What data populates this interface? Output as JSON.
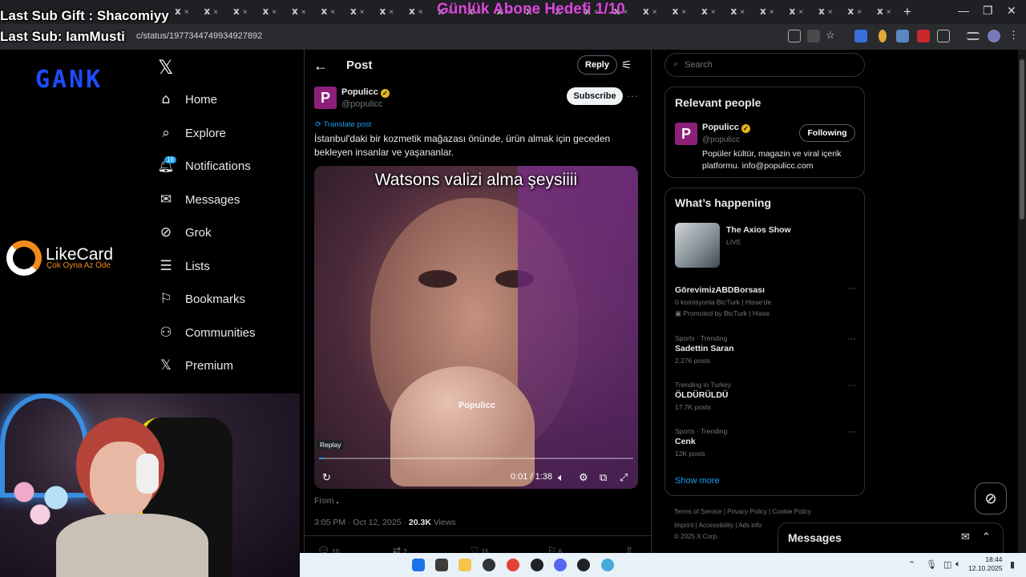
{
  "browser": {
    "tabs": [
      "x",
      "x",
      "x",
      "x",
      "x",
      "x",
      "x",
      "x",
      "x",
      "x",
      "x",
      "x",
      "x",
      "x",
      "x",
      "x",
      "x",
      "x",
      "x",
      "x",
      "x",
      "x",
      "x",
      "x",
      "x"
    ],
    "url_fragment": "c/status/1977344749934927892",
    "new_tab": "+"
  },
  "stream_overlay": {
    "last_sub_gift": "Last Sub Gift : Shacomiyy",
    "last_sub": "Last Sub: IamMusti",
    "goal": "Günlük Abone Hedefi 1/10"
  },
  "sidebar_branding": {
    "gank": "GANK",
    "likecard_name": "LikeCard",
    "likecard_tagline": "Çok Oyna  Az Öde"
  },
  "nav": {
    "items": [
      {
        "label": "Home",
        "icon": "home-icon"
      },
      {
        "label": "Explore",
        "icon": "search-icon"
      },
      {
        "label": "Notifications",
        "icon": "bell-icon"
      },
      {
        "label": "Messages",
        "icon": "mail-icon"
      },
      {
        "label": "Grok",
        "icon": "grok-icon"
      },
      {
        "label": "Lists",
        "icon": "list-icon"
      },
      {
        "label": "Bookmarks",
        "icon": "bookmark-icon"
      },
      {
        "label": "Communities",
        "icon": "people-icon"
      },
      {
        "label": "Premium",
        "icon": "x-icon"
      }
    ],
    "notifications_badge": "16"
  },
  "post_header": {
    "title": "Post",
    "reply_label": "Reply"
  },
  "post": {
    "avatar_letter": "P",
    "author_name": "Populicc",
    "author_handle": "@populicc",
    "subscribe_label": "Subscribe",
    "translate_label": "Translate post",
    "text": "İstanbul'daki bir kozmetik mağazası önünde, ürün almak için geceden bekleyen insanlar ve yaşananlar.",
    "video": {
      "caption": "Watsons valizi alma şeysiiii",
      "watermark": "Populicc",
      "replay_tooltip": "Replay",
      "time": "0:01 / 1:38",
      "progress": 0.012
    },
    "from_label": "From",
    "from_value": ".",
    "timestamp": "3:05 PM · Oct 12, 2025 · ",
    "views_count": "20.3K",
    "views_label": " Views",
    "actions": [
      {
        "icon": "reply-icon",
        "count": "10"
      },
      {
        "icon": "repost-icon",
        "count": "2"
      },
      {
        "icon": "like-icon",
        "count": "15"
      },
      {
        "icon": "bookmark-icon",
        "count": "6"
      },
      {
        "icon": "share-icon",
        "count": ""
      }
    ]
  },
  "search": {
    "placeholder": "Search"
  },
  "relevant_people": {
    "title": "Relevant people",
    "avatar_letter": "P",
    "name": "Populicc",
    "handle": "@populicc",
    "button": "Following",
    "bio": "Popüler kültür, magazin ve viral içerik platformu. info@populicc.com"
  },
  "whats_happening": {
    "title": "What’s happening",
    "featured": {
      "name": "The Axios Show",
      "status": "LIVE"
    },
    "trends": [
      {
        "context": "",
        "name": "GörevimizABDBorsası",
        "count": "0 komisyonla BtcTurk | Hisse'de",
        "promo": "Promoted by BtcTurk | Hisse"
      },
      {
        "context": "Sports · Trending",
        "name": "Sadettin Saran",
        "count": "2,276 posts",
        "promo": ""
      },
      {
        "context": "Trending in Turkey",
        "name": "ÖLDÜRÜLDÜ",
        "count": "17.7K posts",
        "promo": ""
      },
      {
        "context": "Sports · Trending",
        "name": "Cenk",
        "count": "12K posts",
        "promo": ""
      }
    ],
    "show_more": "Show more"
  },
  "footer": {
    "line1": [
      "Terms of Service",
      "Privacy Policy",
      "Cookie Policy"
    ],
    "line2": [
      "Imprint",
      "Accessibility",
      "Ads info"
    ],
    "copyright": "© 2025 X Corp."
  },
  "messages_dock": {
    "title": "Messages"
  },
  "taskbar": {
    "time": "18:44",
    "date": "12.10.2025"
  },
  "colors": {
    "accent": "#1d9bf0",
    "goal_text": "#d34bd6",
    "gank_blue": "#1e4cff",
    "likecard_orange": "#f08a1c",
    "brand_avatar": "#8c1f7a"
  }
}
